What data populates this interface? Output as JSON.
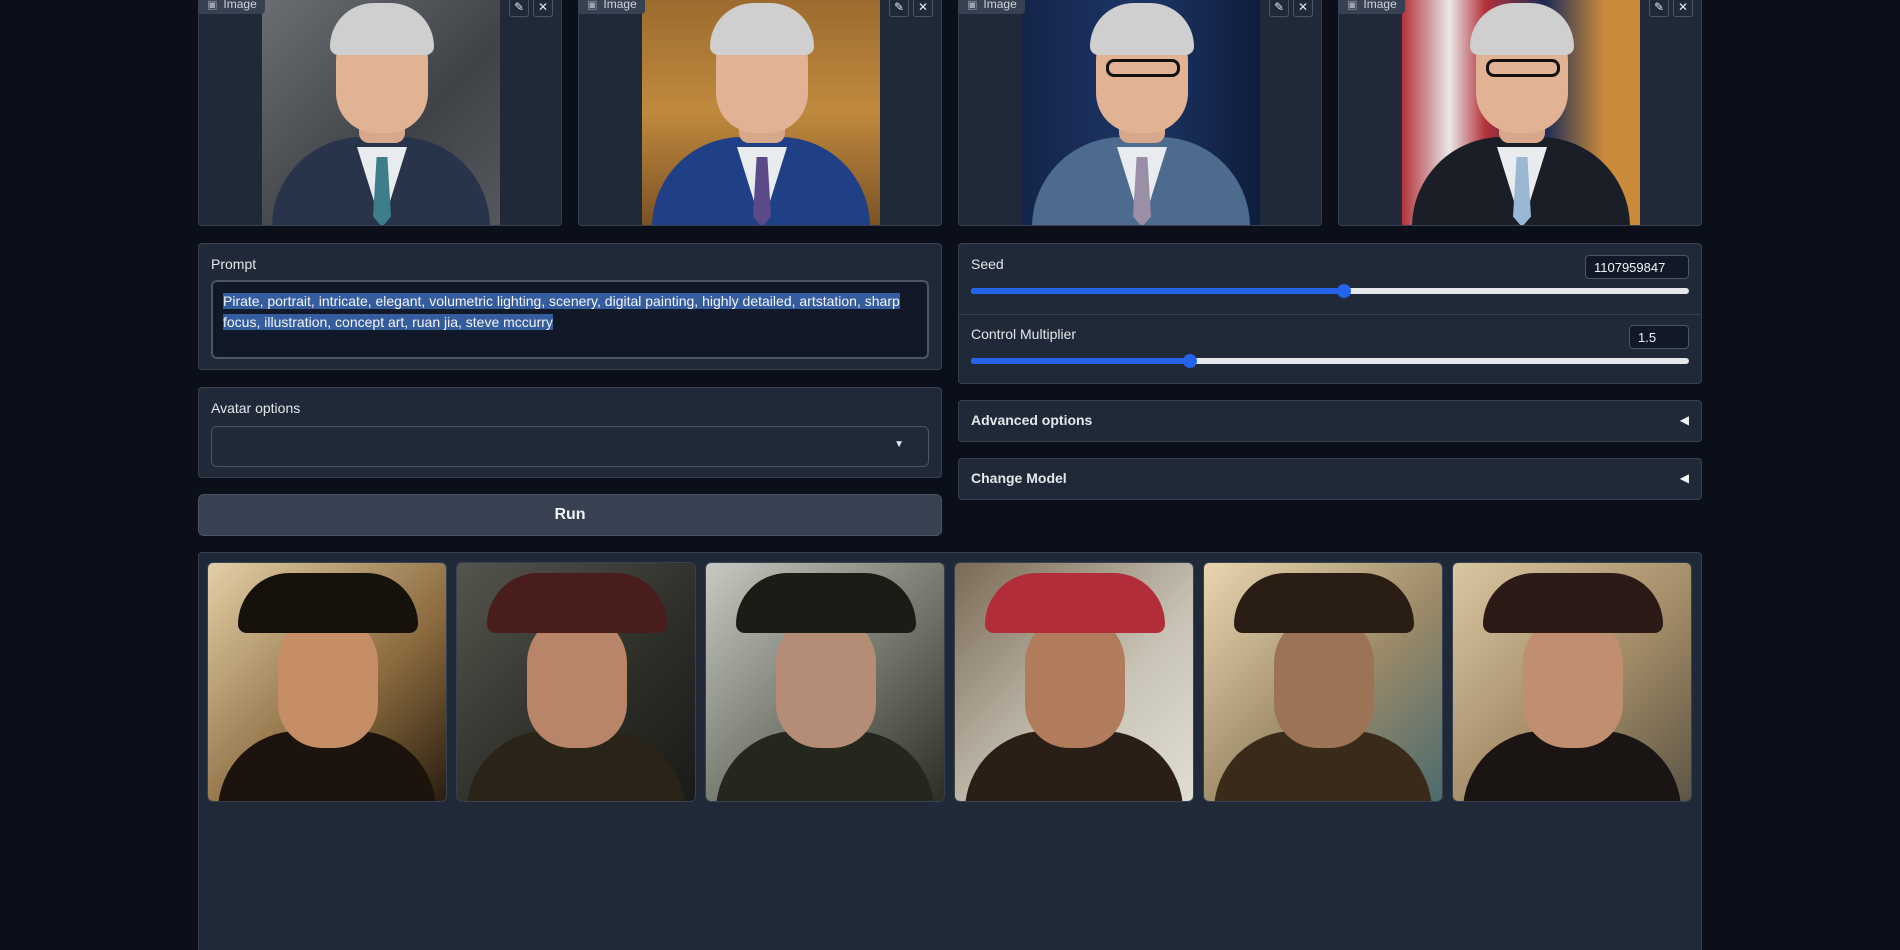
{
  "image_inputs": [
    {
      "label": "Image",
      "edit_icon": "pencil-icon",
      "close_icon": "close-icon"
    },
    {
      "label": "Image",
      "edit_icon": "pencil-icon",
      "close_icon": "close-icon"
    },
    {
      "label": "Image",
      "edit_icon": "pencil-icon",
      "close_icon": "close-icon"
    },
    {
      "label": "Image",
      "edit_icon": "pencil-icon",
      "close_icon": "close-icon"
    }
  ],
  "prompt": {
    "label": "Prompt",
    "value": "Pirate, portrait, intricate, elegant, volumetric lighting, scenery, digital painting, highly detailed, artstation, sharp focus, illustration, concept art, ruan jia, steve mccurry"
  },
  "avatar_options": {
    "label": "Avatar options",
    "selected": ""
  },
  "run_button": {
    "label": "Run"
  },
  "seed": {
    "label": "Seed",
    "value": "1107959847",
    "fraction": 0.52
  },
  "control_multiplier": {
    "label": "Control Multiplier",
    "value": "1.5",
    "fraction": 0.305
  },
  "advanced_options": {
    "label": "Advanced options",
    "arrow": "◀"
  },
  "change_model": {
    "label": "Change Model",
    "arrow": "◀"
  },
  "gallery": {
    "count": 6
  },
  "colors": {
    "accent": "#2563eb",
    "panel": "#1f2937",
    "background": "#0b0f19"
  }
}
